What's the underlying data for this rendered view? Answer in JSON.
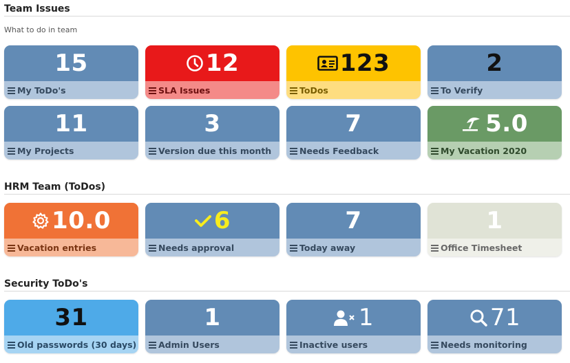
{
  "sections": [
    {
      "title": "Team Issues",
      "description": "What to do in team",
      "tiles": [
        {
          "value": "15",
          "label": "My ToDo's",
          "icon": null
        },
        {
          "value": "12",
          "label": "SLA Issues",
          "icon": "clock-icon"
        },
        {
          "value": "123",
          "label": "ToDos",
          "icon": "id-card-icon"
        },
        {
          "value": "2",
          "label": "To Verify",
          "icon": null
        },
        {
          "value": "11",
          "label": "My Projects",
          "icon": null
        },
        {
          "value": "3",
          "label": "Version due this month",
          "icon": null
        },
        {
          "value": "7",
          "label": "Needs Feedback",
          "icon": null
        },
        {
          "value": "5.0",
          "label": "My Vacation 2020",
          "icon": "umbrella-beach-icon"
        }
      ]
    },
    {
      "title": "HRM Team (ToDos)",
      "tiles": [
        {
          "value": "10.0",
          "label": "Vacation entries",
          "icon": "gear-icon"
        },
        {
          "value": "6",
          "label": "Needs approval",
          "icon": "check-icon"
        },
        {
          "value": "7",
          "label": "Today away",
          "icon": null
        },
        {
          "value": "1",
          "label": "Office Timesheet",
          "icon": null
        }
      ]
    },
    {
      "title": "Security ToDo's",
      "tiles": [
        {
          "value": "31",
          "label": "Old passwords (30 days)",
          "icon": null
        },
        {
          "value": "1",
          "label": "Admin Users",
          "icon": null
        },
        {
          "value": "1",
          "label": "Inactive users",
          "icon": "user-times-icon"
        },
        {
          "value": "71",
          "label": "Needs monitoring",
          "icon": "search-icon"
        }
      ]
    }
  ],
  "colors": {
    "blue_top": "#628bb5",
    "blue_bottom": "#b0c5dc",
    "blue_text": "#35495e",
    "red_top": "#e8191a",
    "red_bottom": "#f48a88",
    "red_text": "#6e1010",
    "yellow_top": "#fec300",
    "yellow_bottom": "#fedd80",
    "yellow_text": "#7a5e00",
    "green_top": "#6a9a65",
    "green_bottom": "#b6cfb2",
    "green_text": "#2f4a2c",
    "orange_top": "#f07236",
    "orange_bottom": "#f7b898",
    "orange_text": "#7a3412",
    "grey_top": "#e0e3d6",
    "grey_bottom": "#eff0e9",
    "grey_text": "#686868",
    "lightblue_top": "#4eaae8",
    "lightblue_bottom": "#a6d4f3",
    "lightblue_text": "#2a4a66",
    "check_yellow": "#f7ec1e"
  }
}
